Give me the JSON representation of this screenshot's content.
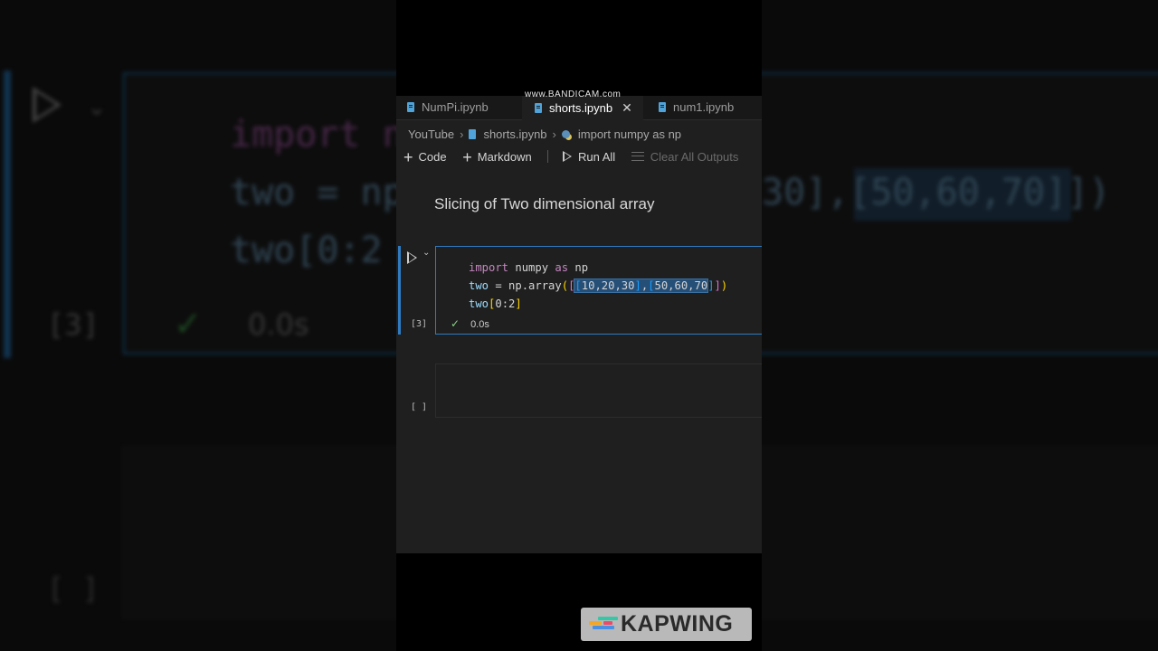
{
  "background": {
    "code_lines": [
      "import n",
      "two = np",
      "two[0:2"
    ],
    "code_fragment": "30],[50,60,70]])",
    "exec_count": "[3]",
    "time": "0.0s",
    "empty_count": "[ ]"
  },
  "watermark": "www.BANDICAM.com",
  "tabs": [
    {
      "label": "NumPi.ipynb",
      "active": false
    },
    {
      "label": "shorts.ipynb",
      "active": true,
      "close": "✕"
    },
    {
      "label": "num1.ipynb",
      "active": false
    }
  ],
  "breadcrumb": [
    "YouTube",
    "shorts.ipynb",
    "import numpy as np"
  ],
  "toolbar": {
    "code_label": "Code",
    "markdown_label": "Markdown",
    "run_all_label": "Run All",
    "clear_label": "Clear All Outputs"
  },
  "markdown_cell": {
    "text": "Slicing of Two dimensional array"
  },
  "code_cell": {
    "exec_count": "[3]",
    "lines": [
      "import numpy as np",
      "two = np.array([[10,20,30],[50,60,70]])",
      "two[0:2]"
    ],
    "status_time": "0.0s"
  },
  "empty_cell": {
    "exec_count": "[ ]"
  },
  "badge": {
    "text": "KAPWING",
    "colors": [
      "#35c8a7",
      "#f5a623",
      "#e84c6a",
      "#4a90e2"
    ]
  }
}
